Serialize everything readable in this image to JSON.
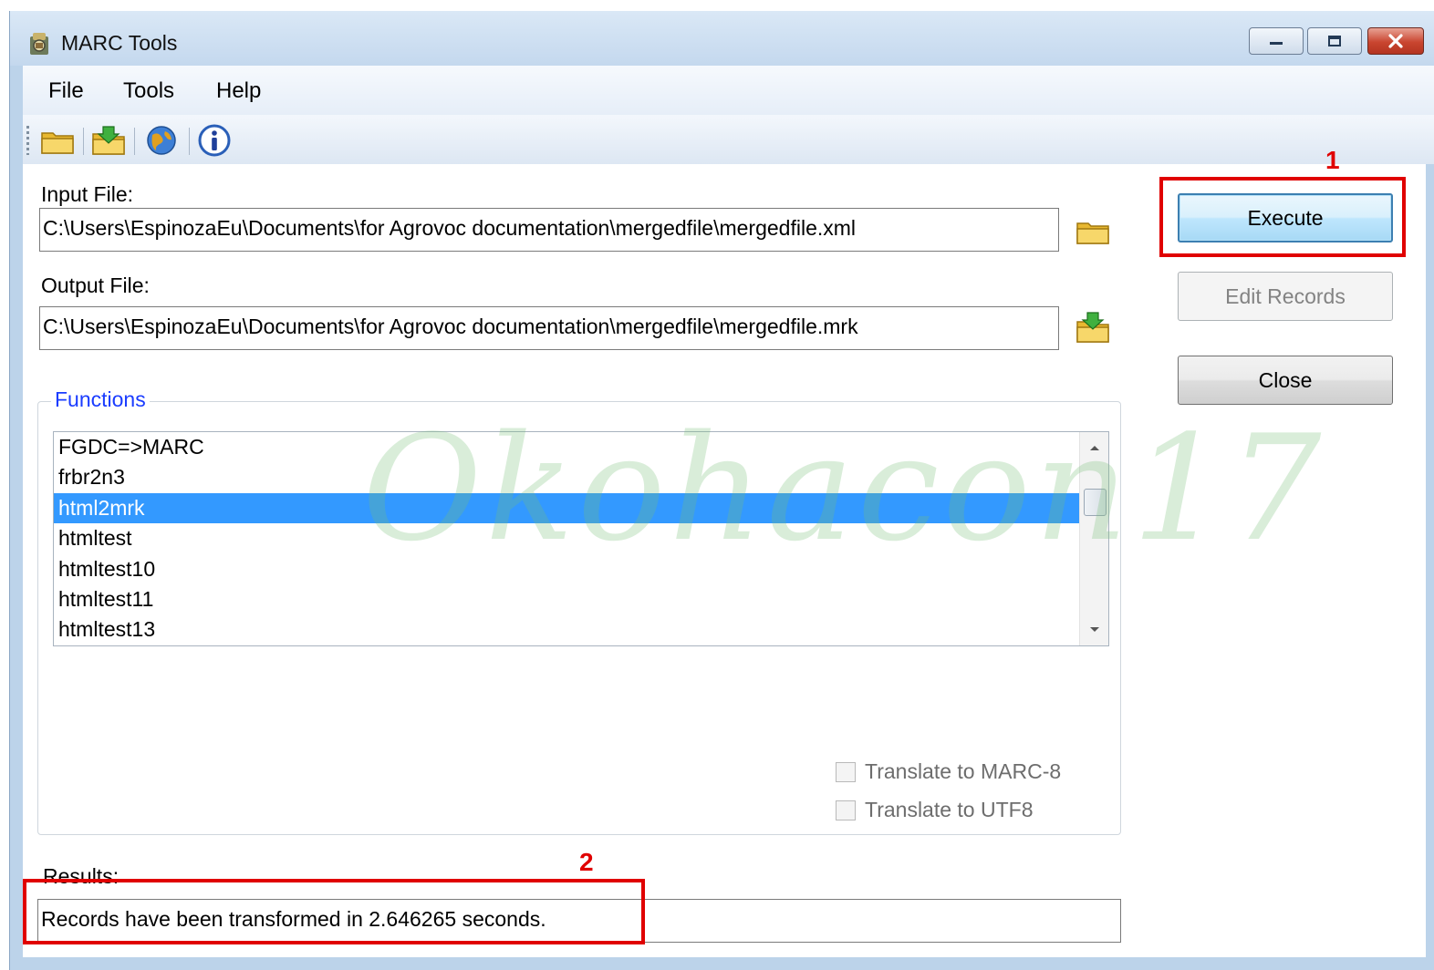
{
  "window": {
    "title": "MARC Tools"
  },
  "menu": {
    "file": "File",
    "tools": "Tools",
    "help": "Help"
  },
  "toolbar": {
    "buttons": [
      {
        "icon": "open-folder-icon"
      },
      {
        "icon": "save-folder-icon"
      },
      {
        "icon": "globe-icon"
      },
      {
        "icon": "info-icon"
      }
    ]
  },
  "input_file": {
    "label": "Input File:",
    "value": "C:\\Users\\EspinozaEu\\Documents\\for Agrovoc documentation\\mergedfile\\mergedfile.xml"
  },
  "output_file": {
    "label": "Output File:",
    "value": "C:\\Users\\EspinozaEu\\Documents\\for Agrovoc documentation\\mergedfile\\mergedfile.mrk"
  },
  "functions": {
    "title": "Functions",
    "items": [
      "FGDC=>MARC",
      "frbr2n3",
      "html2mrk",
      "htmltest",
      "htmltest10",
      "htmltest11",
      "htmltest13"
    ],
    "selected": "html2mrk"
  },
  "options": {
    "translate_marc8": "Translate to MARC-8",
    "translate_utf8": "Translate to UTF8"
  },
  "buttons": {
    "execute": "Execute",
    "edit_records": "Edit Records",
    "close": "Close"
  },
  "results": {
    "label": "Results:",
    "value": "Records have been transformed in 2.646265 seconds."
  },
  "annotations": {
    "marker_1": "1",
    "marker_2": "2"
  },
  "watermark": "Okohacon17",
  "colors": {
    "selection": "#3399ff",
    "annotation": "#e00000",
    "group_title": "#1a3cff"
  }
}
